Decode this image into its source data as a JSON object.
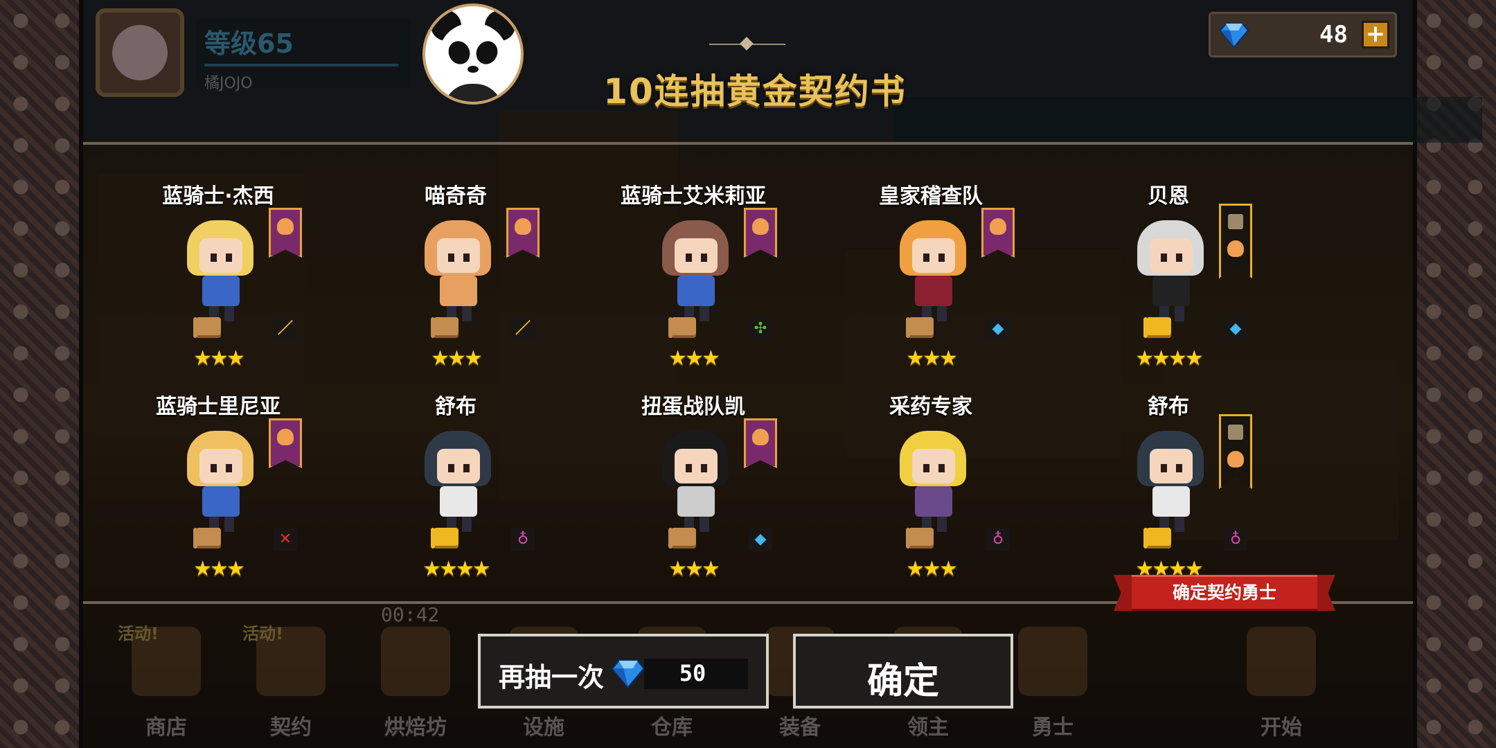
{
  "header": {
    "level_label": "等级65",
    "player_name": "橘JOJO",
    "title": "10连抽黄金契约书",
    "gems": "48",
    "plus_label": "+"
  },
  "heroes": [
    {
      "name": "蓝骑士·杰西",
      "stars": "★★★",
      "class_icon": "sword-icon",
      "class_glyph": "／",
      "class_color": "#f0c020",
      "banner": "purple",
      "scroll": "bronze",
      "hair": "#f0d060",
      "torso": "#3a66c8"
    },
    {
      "name": "喵奇奇",
      "stars": "★★★",
      "class_icon": "sword-icon",
      "class_glyph": "／",
      "class_color": "#f0c020",
      "banner": "purple",
      "scroll": "bronze",
      "hair": "#e8a060",
      "torso": "#e8a060"
    },
    {
      "name": "蓝骑士艾米莉亚",
      "stars": "★★★",
      "class_icon": "cross-icon",
      "class_glyph": "✣",
      "class_color": "#5ac040",
      "banner": "purple",
      "scroll": "bronze",
      "hair": "#8a5a4a",
      "torso": "#3a66c8"
    },
    {
      "name": "皇家稽查队",
      "stars": "★★★",
      "class_icon": "gem-class-icon",
      "class_glyph": "◆",
      "class_color": "#40b8f0",
      "banner": "purple",
      "scroll": "bronze",
      "hair": "#f0a040",
      "torso": "#8a2030"
    },
    {
      "name": "贝恩",
      "stars": "★★★★",
      "class_icon": "gem-class-icon",
      "class_glyph": "◆",
      "class_color": "#40b8f0",
      "banner": "gold",
      "scroll": "gold",
      "hair": "#d8d8d8",
      "torso": "#222222"
    },
    {
      "name": "蓝骑士里尼亚",
      "stars": "★★★",
      "class_icon": "crossed-swords-icon",
      "class_glyph": "✕",
      "class_color": "#e03030",
      "banner": "purple",
      "scroll": "bronze",
      "hair": "#f0c060",
      "torso": "#3a66c8"
    },
    {
      "name": "舒布",
      "stars": "★★★★",
      "class_icon": "potion-icon",
      "class_glyph": "♁",
      "class_color": "#e04ab0",
      "banner": "none",
      "scroll": "gold",
      "hair": "#2e3a48",
      "torso": "#e8e8e8"
    },
    {
      "name": "扭蛋战队凯",
      "stars": "★★★",
      "class_icon": "gem-class-icon",
      "class_glyph": "◆",
      "class_color": "#40b8f0",
      "banner": "purple",
      "scroll": "bronze",
      "hair": "#1a1a1a",
      "torso": "#cccccc"
    },
    {
      "name": "采药专家",
      "stars": "★★★",
      "class_icon": "potion-icon",
      "class_glyph": "♁",
      "class_color": "#e04ab0",
      "banner": "none",
      "scroll": "bronze",
      "hair": "#f0d040",
      "torso": "#6a4a8a"
    },
    {
      "name": "舒布",
      "stars": "★★★★",
      "class_icon": "potion-icon",
      "class_glyph": "♁",
      "class_color": "#e04ab0",
      "banner": "gold",
      "scroll": "gold",
      "hair": "#2e3a48",
      "torso": "#e8e8e8"
    }
  ],
  "confirm_tag": "确定契约勇士",
  "buttons": {
    "draw_again": "再抽一次",
    "draw_cost": "50",
    "confirm": "确定"
  },
  "background_nav": {
    "timer": "00:42",
    "items": [
      {
        "label": "商店",
        "badge": "活动!"
      },
      {
        "label": "契约",
        "badge": "活动!"
      },
      {
        "label": "烘焙坊",
        "badge": ""
      },
      {
        "label": "设施",
        "badge": ""
      },
      {
        "label": "仓库",
        "badge": ""
      },
      {
        "label": "装备",
        "badge": ""
      },
      {
        "label": "领主",
        "badge": ""
      },
      {
        "label": "勇士",
        "badge": ""
      },
      {
        "label": "开始",
        "badge": ""
      }
    ]
  },
  "colors": {
    "title": "#e8c25a",
    "stars": "#ffd21a",
    "confirm_tag": "#c4221c",
    "gem": "#2a8ae8"
  }
}
